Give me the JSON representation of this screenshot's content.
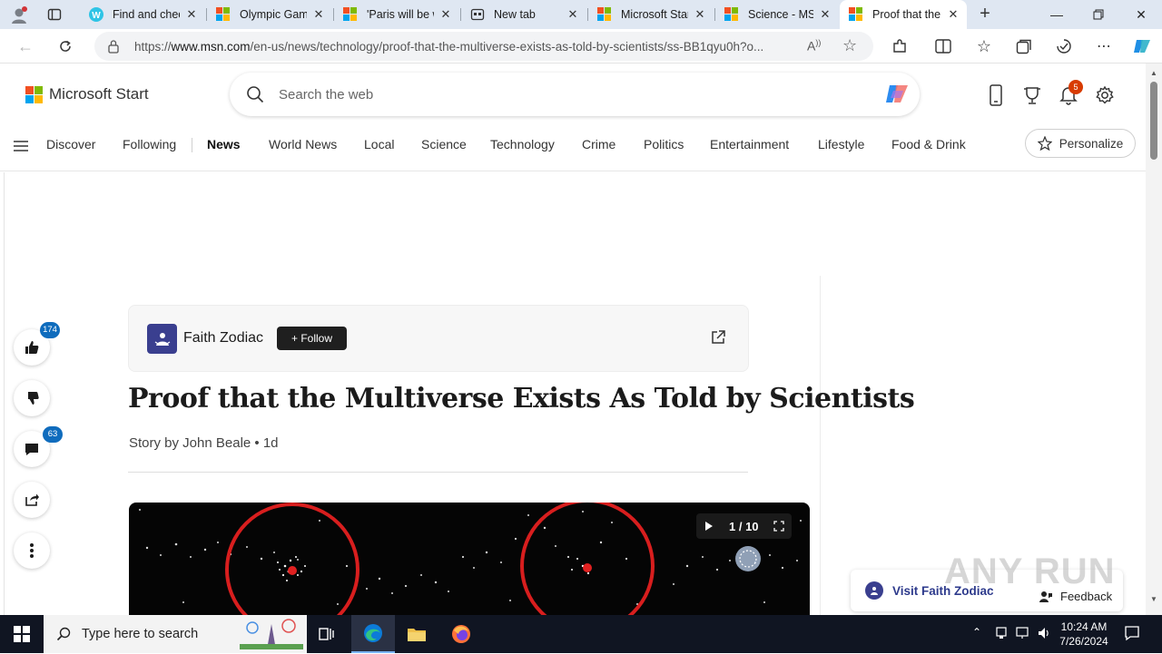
{
  "browser": {
    "tabs": [
      {
        "label": "Find and chec",
        "icon": "w-icon",
        "active": false
      },
      {
        "label": "Olympic Gam",
        "icon": "ms-favicon",
        "active": false
      },
      {
        "label": "'Paris will be w",
        "icon": "ms-favicon",
        "active": false
      },
      {
        "label": "New tab",
        "icon": "newtab-icon",
        "active": false
      },
      {
        "label": "Microsoft Star",
        "icon": "ms-favicon",
        "active": false
      },
      {
        "label": "Science - MSN",
        "icon": "ms-favicon",
        "active": false
      },
      {
        "label": "Proof that the",
        "icon": "ms-favicon",
        "active": true
      }
    ],
    "url_prefix": "https://",
    "url_domain": "www.msn.com",
    "url_path": "/en-us/news/technology/proof-that-the-multiverse-exists-as-told-by-scientists/ss-BB1qyu0h?o..."
  },
  "msn": {
    "brand": "Microsoft Start",
    "search_placeholder": "Search the web",
    "notification_count": "5",
    "nav": [
      "Discover",
      "Following",
      "News",
      "World News",
      "Local",
      "Science",
      "Technology",
      "Crime",
      "Politics",
      "Entertainment",
      "Lifestyle",
      "Food & Drink"
    ],
    "personalize_label": "Personalize"
  },
  "article": {
    "publisher": "Faith Zodiac",
    "follow_label": "+ Follow",
    "title": "Proof that the Multiverse Exists As Told by Scientists",
    "byline": "Story by John Beale • 1d",
    "slide_counter": "1 / 10",
    "likes": "174",
    "comments": "63",
    "visit_label": "Visit Faith Zodiac",
    "feedback_label": "Feedback"
  },
  "watermark": "ANY RUN",
  "taskbar": {
    "search_placeholder": "Type here to search",
    "time": "10:24 AM",
    "date": "7/26/2024"
  },
  "colors": {
    "ms_red": "#f25022",
    "ms_green": "#7fba00",
    "ms_blue": "#00a4ef",
    "ms_yellow": "#ffb900",
    "badge_blue": "#0f6cbd",
    "notif_orange": "#d83b01"
  }
}
